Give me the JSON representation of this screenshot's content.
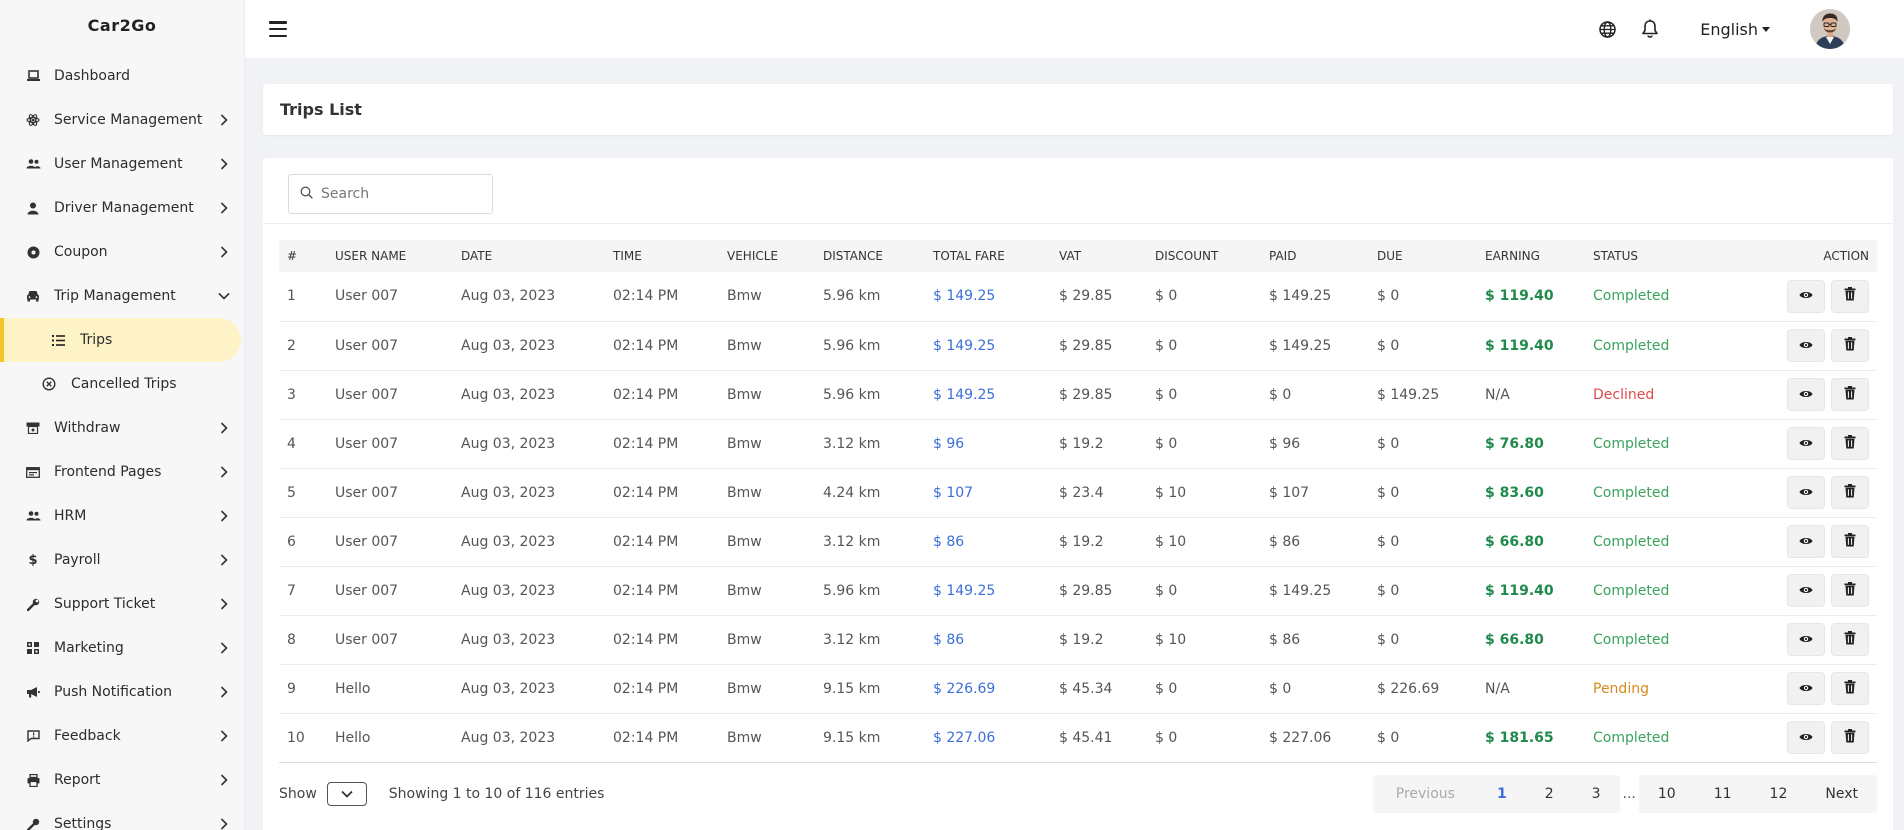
{
  "app": {
    "brand": "Car2Go"
  },
  "sidebar": {
    "items": [
      {
        "label": "Dashboard",
        "icon": "laptop-icon"
      },
      {
        "label": "Service Management",
        "icon": "atom-icon"
      },
      {
        "label": "User Management",
        "icon": "users-icon"
      },
      {
        "label": "Driver Management",
        "icon": "user-icon"
      },
      {
        "label": "Coupon",
        "icon": "coupon-icon"
      },
      {
        "label": "Trip Management",
        "icon": "car-icon"
      },
      {
        "label": "Withdraw",
        "icon": "withdraw-icon"
      },
      {
        "label": "Frontend Pages",
        "icon": "pages-icon"
      },
      {
        "label": "HRM",
        "icon": "team-icon"
      },
      {
        "label": "Payroll",
        "icon": "dollar-icon"
      },
      {
        "label": "Support Ticket",
        "icon": "wrench-icon"
      },
      {
        "label": "Marketing",
        "icon": "grid-icon"
      },
      {
        "label": "Push Notification",
        "icon": "megaphone-icon"
      },
      {
        "label": "Feedback",
        "icon": "feedback-icon"
      },
      {
        "label": "Report",
        "icon": "printer-icon"
      },
      {
        "label": "Settings",
        "icon": "settings-icon"
      }
    ],
    "trip_sub": [
      {
        "label": "Trips",
        "icon": "list-icon"
      },
      {
        "label": "Cancelled Trips",
        "icon": "cancel-circle-icon"
      }
    ]
  },
  "topbar": {
    "language": "English"
  },
  "page": {
    "title": "Trips List"
  },
  "search": {
    "placeholder": "Search"
  },
  "table": {
    "columns": [
      "#",
      "USER NAME",
      "DATE",
      "TIME",
      "VEHICLE",
      "DISTANCE",
      "TOTAL FARE",
      "VAT",
      "DISCOUNT",
      "PAID",
      "DUE",
      "EARNING",
      "STATUS",
      "ACTION"
    ],
    "rows": [
      {
        "no": "1",
        "user": "User 007",
        "date": "Aug 03, 2023",
        "time": "02:14 PM",
        "vehicle": "Bmw",
        "distance": "5.96 km",
        "fare": "$ 149.25",
        "vat": "$ 29.85",
        "discount": "$ 0",
        "paid": "$ 149.25",
        "due": "$ 0",
        "earning": "$ 119.40",
        "status": "Completed"
      },
      {
        "no": "2",
        "user": "User 007",
        "date": "Aug 03, 2023",
        "time": "02:14 PM",
        "vehicle": "Bmw",
        "distance": "5.96 km",
        "fare": "$ 149.25",
        "vat": "$ 29.85",
        "discount": "$ 0",
        "paid": "$ 149.25",
        "due": "$ 0",
        "earning": "$ 119.40",
        "status": "Completed"
      },
      {
        "no": "3",
        "user": "User 007",
        "date": "Aug 03, 2023",
        "time": "02:14 PM",
        "vehicle": "Bmw",
        "distance": "5.96 km",
        "fare": "$ 149.25",
        "vat": "$ 29.85",
        "discount": "$ 0",
        "paid": "$ 0",
        "due": "$ 149.25",
        "earning": "N/A",
        "status": "Declined"
      },
      {
        "no": "4",
        "user": "User 007",
        "date": "Aug 03, 2023",
        "time": "02:14 PM",
        "vehicle": "Bmw",
        "distance": "3.12 km",
        "fare": "$ 96",
        "vat": "$ 19.2",
        "discount": "$ 0",
        "paid": "$ 96",
        "due": "$ 0",
        "earning": "$ 76.80",
        "status": "Completed"
      },
      {
        "no": "5",
        "user": "User 007",
        "date": "Aug 03, 2023",
        "time": "02:14 PM",
        "vehicle": "Bmw",
        "distance": "4.24 km",
        "fare": "$ 107",
        "vat": "$ 23.4",
        "discount": "$ 10",
        "paid": "$ 107",
        "due": "$ 0",
        "earning": "$ 83.60",
        "status": "Completed"
      },
      {
        "no": "6",
        "user": "User 007",
        "date": "Aug 03, 2023",
        "time": "02:14 PM",
        "vehicle": "Bmw",
        "distance": "3.12 km",
        "fare": "$ 86",
        "vat": "$ 19.2",
        "discount": "$ 10",
        "paid": "$ 86",
        "due": "$ 0",
        "earning": "$ 66.80",
        "status": "Completed"
      },
      {
        "no": "7",
        "user": "User 007",
        "date": "Aug 03, 2023",
        "time": "02:14 PM",
        "vehicle": "Bmw",
        "distance": "5.96 km",
        "fare": "$ 149.25",
        "vat": "$ 29.85",
        "discount": "$ 0",
        "paid": "$ 149.25",
        "due": "$ 0",
        "earning": "$ 119.40",
        "status": "Completed"
      },
      {
        "no": "8",
        "user": "User 007",
        "date": "Aug 03, 2023",
        "time": "02:14 PM",
        "vehicle": "Bmw",
        "distance": "3.12 km",
        "fare": "$ 86",
        "vat": "$ 19.2",
        "discount": "$ 10",
        "paid": "$ 86",
        "due": "$ 0",
        "earning": "$ 66.80",
        "status": "Completed"
      },
      {
        "no": "9",
        "user": "Hello",
        "date": "Aug 03, 2023",
        "time": "02:14 PM",
        "vehicle": "Bmw",
        "distance": "9.15 km",
        "fare": "$ 226.69",
        "vat": "$ 45.34",
        "discount": "$ 0",
        "paid": "$ 0",
        "due": "$ 226.69",
        "earning": "N/A",
        "status": "Pending"
      },
      {
        "no": "10",
        "user": "Hello",
        "date": "Aug 03, 2023",
        "time": "02:14 PM",
        "vehicle": "Bmw",
        "distance": "9.15 km",
        "fare": "$ 227.06",
        "vat": "$ 45.41",
        "discount": "$ 0",
        "paid": "$ 227.06",
        "due": "$ 0",
        "earning": "$ 181.65",
        "status": "Completed"
      }
    ]
  },
  "footer": {
    "show_label": "Show",
    "entries_text": "Showing 1 to 10 of 116 entries",
    "pagination": {
      "previous": "Previous",
      "pages_left": [
        "1",
        "2",
        "3"
      ],
      "ellipsis": "...",
      "pages_right": [
        "10",
        "11",
        "12"
      ],
      "next": "Next",
      "current": "1"
    }
  },
  "colors": {
    "active_bg": "#fdf3c6",
    "active_accent": "#f3c52b",
    "fare_blue": "#3b6fd9",
    "earning_green": "#1f8a4c",
    "status_completed": "#3aa35c",
    "status_declined": "#e04a4a",
    "status_pending": "#d98a1e"
  }
}
